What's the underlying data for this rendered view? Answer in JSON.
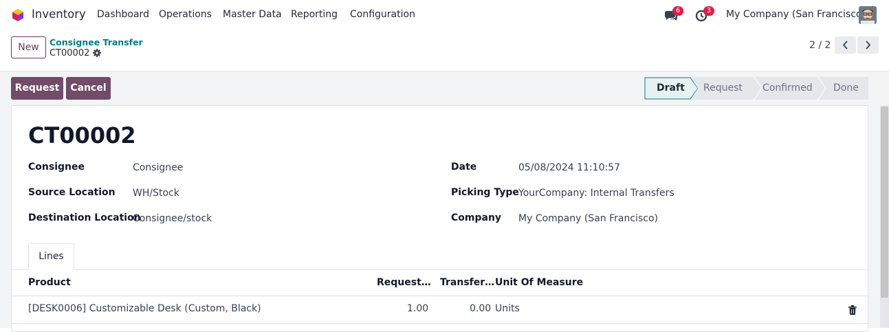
{
  "navbar": {
    "app_name": "Inventory",
    "menu": [
      "Dashboard",
      "Operations",
      "Master Data",
      "Reporting",
      "Configuration"
    ],
    "messages_badge": "6",
    "activities_badge": "3",
    "company": "My Company (San Francisco)"
  },
  "control_panel": {
    "new_label": "New",
    "breadcrumb_parent": "Consignee Transfer",
    "breadcrumb_current": "CT00002",
    "pager": "2 / 2"
  },
  "statusbar": {
    "buttons": [
      "Request",
      "Cancel"
    ],
    "stages": [
      "Draft",
      "Request",
      "Confirmed",
      "Done"
    ],
    "active_stage": "Draft"
  },
  "record": {
    "title": "CT00002",
    "left_fields": [
      {
        "label": "Consignee",
        "value": "Consignee"
      },
      {
        "label": "Source Location",
        "value": "WH/Stock"
      },
      {
        "label": "Destination Location",
        "value": "Consignee/stock"
      }
    ],
    "right_fields": [
      {
        "label": "Date",
        "value": "05/08/2024 11:10:57"
      },
      {
        "label": "Picking Type",
        "value": "YourCompany: Internal Transfers"
      },
      {
        "label": "Company",
        "value": "My Company (San Francisco)"
      }
    ]
  },
  "tabs": [
    "Lines"
  ],
  "lines_table": {
    "headers": [
      "Product",
      "Request…",
      "Transfer…",
      "Unit Of Measure"
    ],
    "rows": [
      {
        "product": "[DESK0006] Customizable Desk (Custom, Black)",
        "requested": "1.00",
        "transferred": "0.00",
        "uom": "Units"
      }
    ]
  },
  "colors": {
    "primary": "#714b67",
    "link": "#017e84",
    "badge": "#e11d48"
  }
}
